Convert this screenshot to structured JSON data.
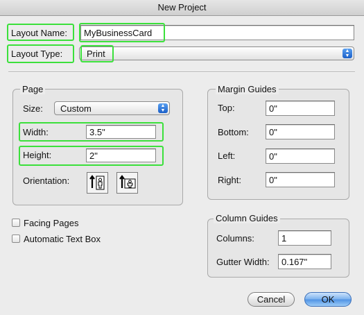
{
  "window": {
    "title": "New Project"
  },
  "layout": {
    "name_label": "Layout Name:",
    "name_value": "MyBusinessCard",
    "type_label": "Layout Type:",
    "type_value": "Print"
  },
  "page": {
    "group_title": "Page",
    "size_label": "Size:",
    "size_value": "Custom",
    "width_label": "Width:",
    "width_value": "3.5\"",
    "height_label": "Height:",
    "height_value": "2\"",
    "orientation_label": "Orientation:"
  },
  "margins": {
    "group_title": "Margin Guides",
    "top_label": "Top:",
    "top_value": "0\"",
    "bottom_label": "Bottom:",
    "bottom_value": "0\"",
    "left_label": "Left:",
    "left_value": "0\"",
    "right_label": "Right:",
    "right_value": "0\""
  },
  "options": {
    "facing_pages_label": "Facing Pages",
    "facing_pages_checked": false,
    "auto_text_box_label": "Automatic Text Box",
    "auto_text_box_checked": false
  },
  "columns": {
    "group_title": "Column Guides",
    "columns_label": "Columns:",
    "columns_value": "1",
    "gutter_label": "Gutter Width:",
    "gutter_value": "0.167\""
  },
  "buttons": {
    "cancel": "Cancel",
    "ok": "OK"
  },
  "colors": {
    "highlight": "#3be03b",
    "default_button": "#4f92e4"
  }
}
